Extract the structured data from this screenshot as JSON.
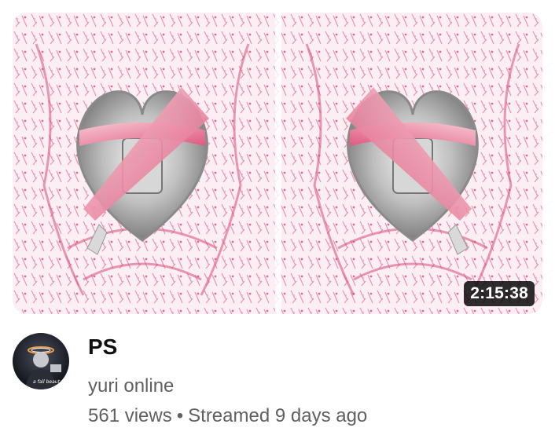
{
  "video": {
    "title": "PS",
    "channel": "yuri online",
    "views": "561 views",
    "separator": "•",
    "streamed": "Streamed 9 days ago",
    "duration": "2:15:38"
  },
  "thumbnail": {
    "description_icon": "twin-ribbon-heart-artwork",
    "background_color": "#fbeff3",
    "pattern_color": "#e36b90",
    "ribbon_color": "#f2a7bd",
    "heart_color": "#c9c9c9"
  },
  "avatar": {
    "icon": "channel-avatar",
    "caption": "a fall beaut"
  }
}
